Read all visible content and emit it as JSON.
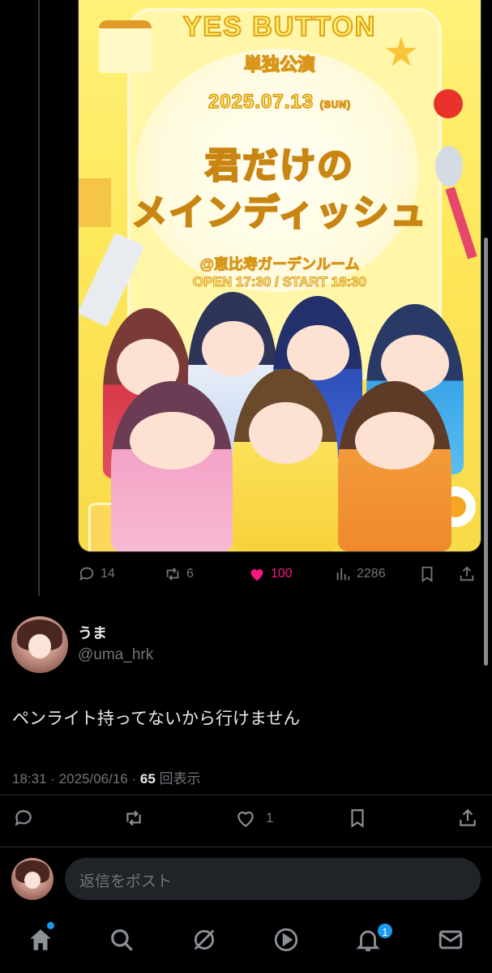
{
  "poster": {
    "logo": "YES BUTTON",
    "subtitle": "単独公演",
    "date": "2025.07.13",
    "weekday": "(SUN)",
    "title_line1": "君だけの",
    "title_line2": "メインディッシュ",
    "venue": "@恵比寿ガーデンルーム",
    "time": "OPEN 17:30 / START 18:30"
  },
  "parent_actions": {
    "replies": "14",
    "reposts": "6",
    "likes": "100",
    "views": "2286"
  },
  "reply": {
    "display_name": "うま",
    "handle": "@uma_hrk",
    "text": "ペンライト持ってないから行けません",
    "time": "18:31",
    "date": "2025/06/16",
    "views_count": "65",
    "views_label": "回表示",
    "likes": "1"
  },
  "composer": {
    "placeholder": "返信をポスト"
  },
  "tabbar": {
    "notifications_badge": "1"
  },
  "colors": {
    "background": "#000000",
    "text": "#e7e9ea",
    "muted": "#71767b",
    "like": "#f91880",
    "accent": "#1d9bf0"
  }
}
